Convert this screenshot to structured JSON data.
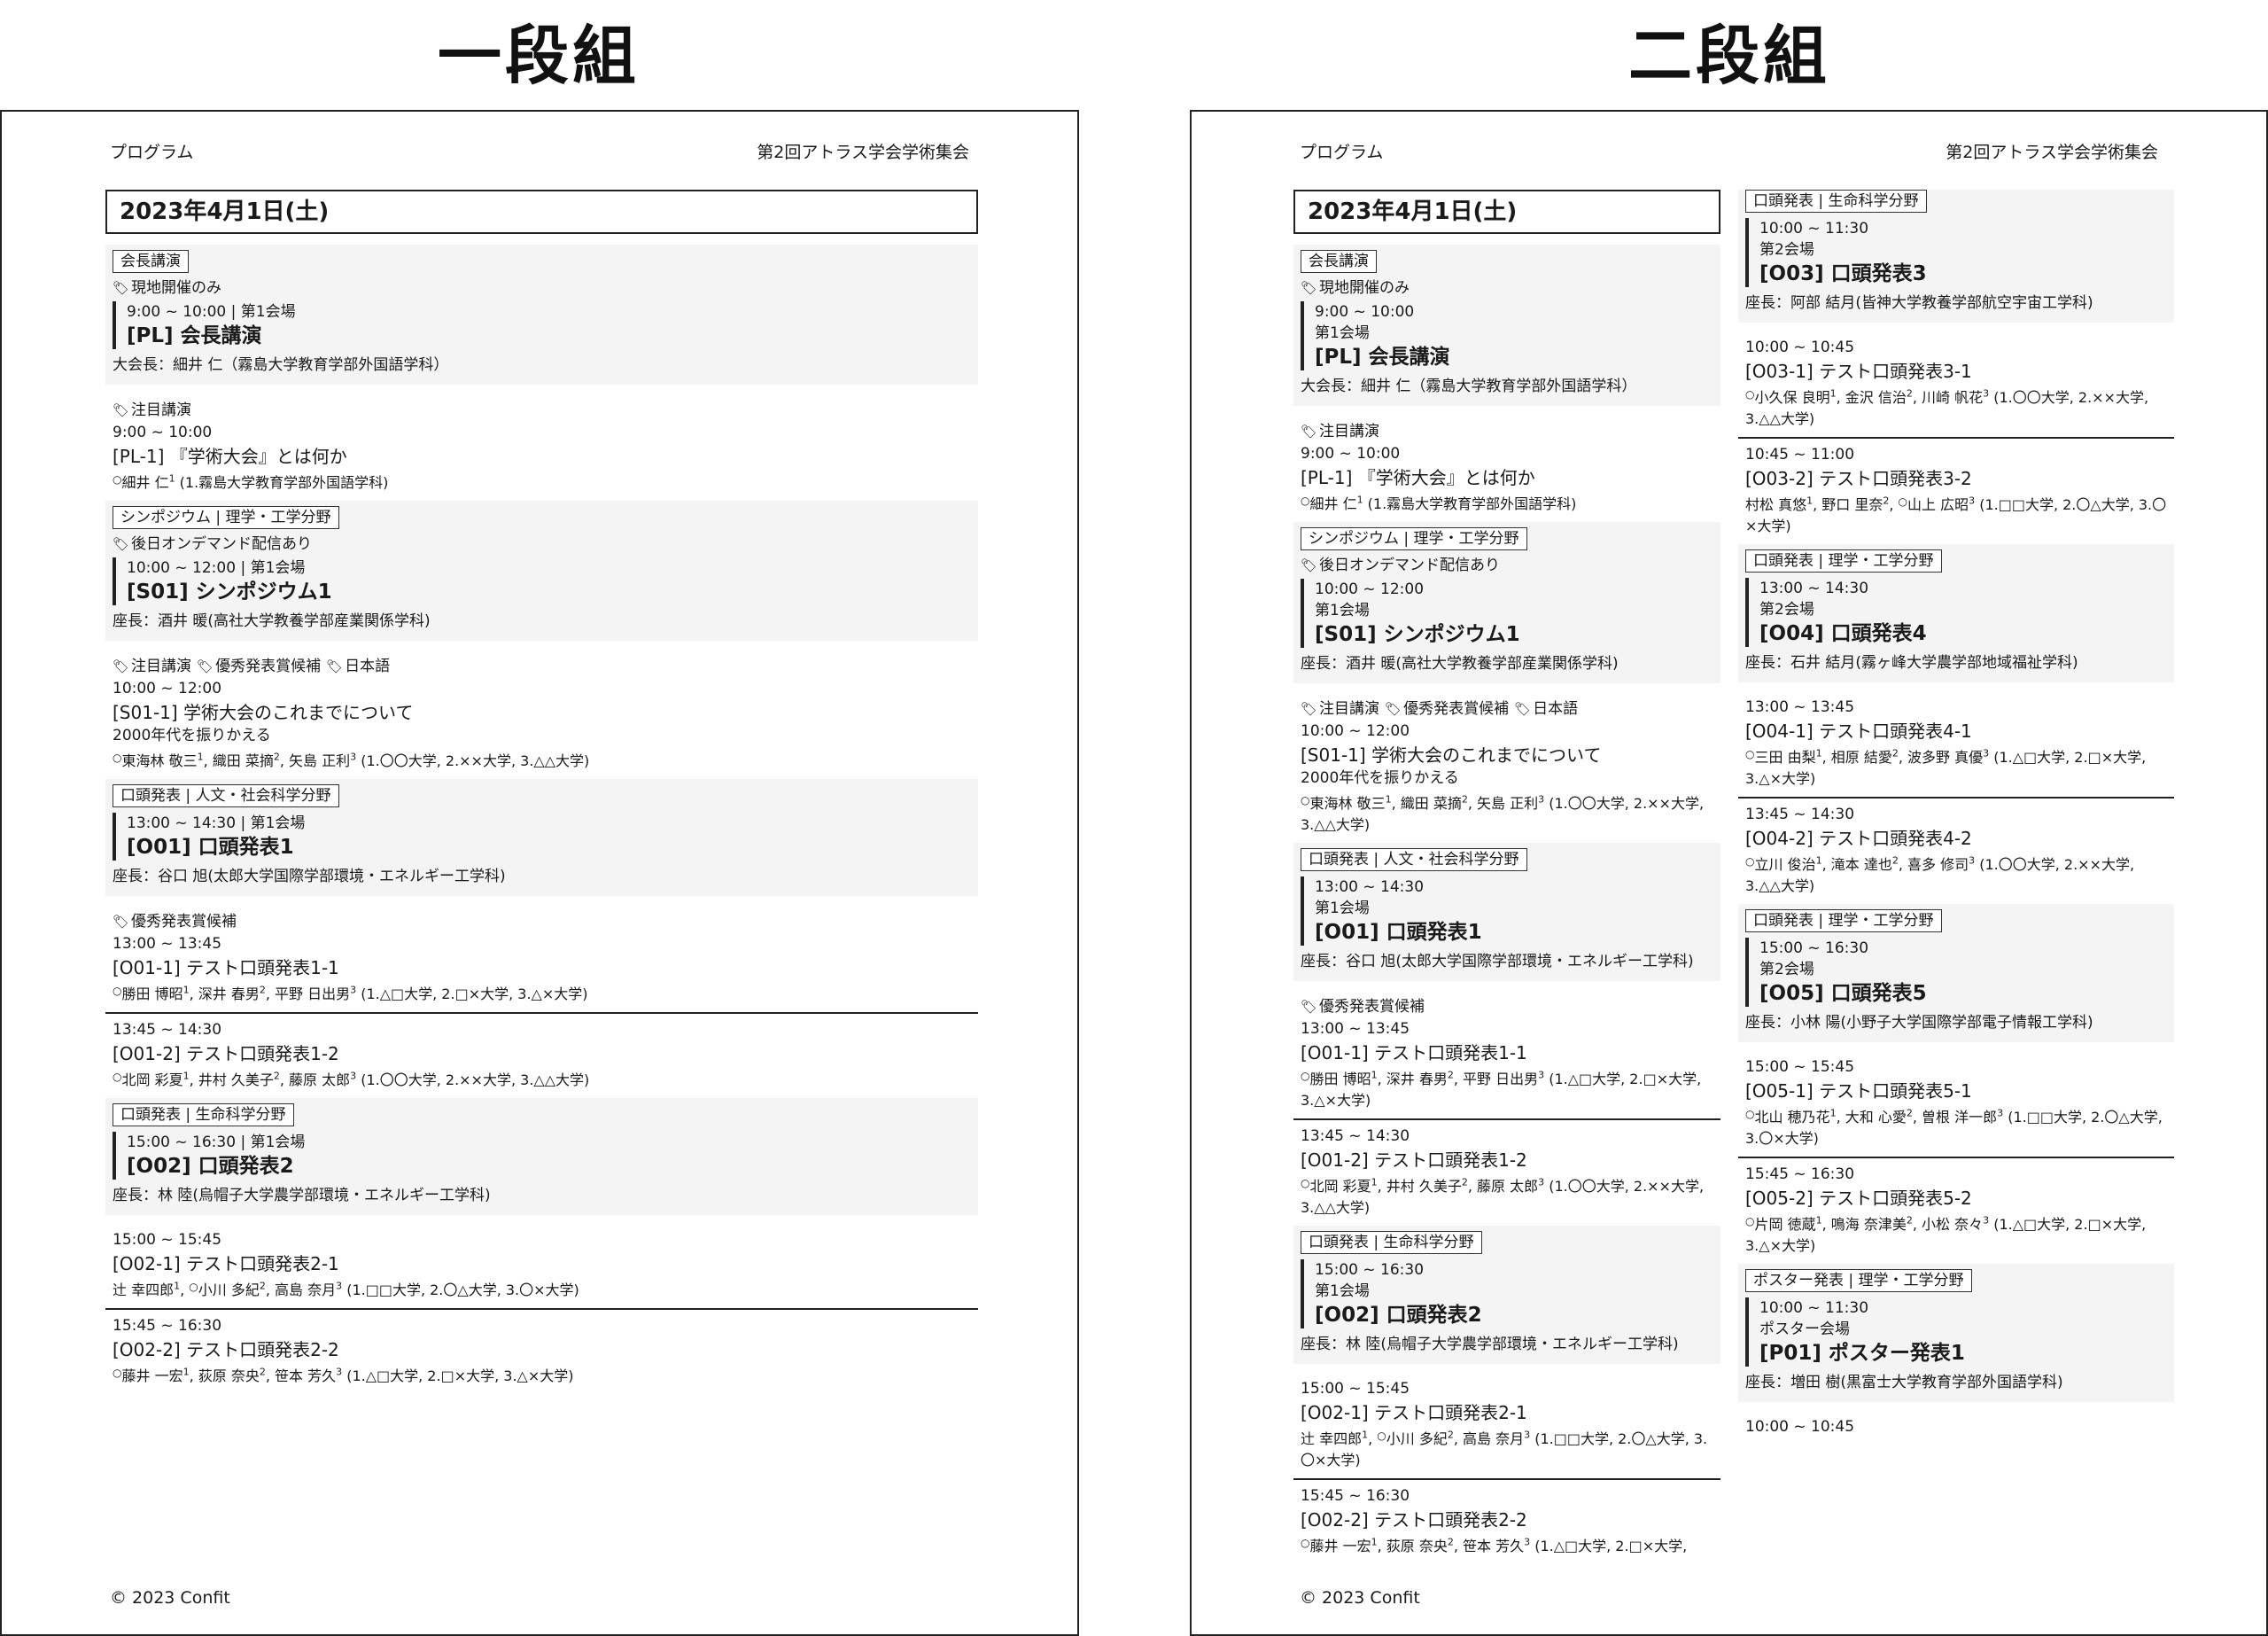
{
  "headings": {
    "single": "一段組",
    "double": "二段組"
  },
  "page_header": {
    "left": "プログラム",
    "right": "第2回アトラス学会学術集会"
  },
  "footer": "© 2023 Confit",
  "date": "2023年4月1日(土)",
  "presenter_mark": "○",
  "icons": {
    "tag": "tag-icon"
  },
  "sessions": [
    {
      "category": "会長講演",
      "tags": [
        "現地開催のみ"
      ],
      "time": "9:00 ~ 10:00",
      "room": "第1会場",
      "title": "[PL] 会長講演",
      "chair": "大会長：細井 仁（霧島大学教育学部外国語学科）",
      "talks": [
        {
          "tags": [
            "注目講演"
          ],
          "time": "9:00 ~ 10:00",
          "title": "[PL-1] 『学術大会』とは何か",
          "subtitle": "",
          "authors": [
            {
              "name": "細井 仁",
              "n": "1",
              "presenter": true
            }
          ],
          "affiliations": "(1.霧島大学教育学部外国語学科)"
        }
      ]
    },
    {
      "category": "シンポジウム | 理学・工学分野",
      "tags": [
        "後日オンデマンド配信あり"
      ],
      "time": "10:00 ~ 12:00",
      "room": "第1会場",
      "title": "[S01] シンポジウム1",
      "chair": "座長：酒井 暖(高社大学教養学部産業関係学科)",
      "talks": [
        {
          "tags": [
            "注目講演",
            "優秀発表賞候補",
            "日本語"
          ],
          "time": "10:00 ~ 12:00",
          "title": "[S01-1] 学術大会のこれまでについて",
          "subtitle": "2000年代を振りかえる",
          "authors": [
            {
              "name": "東海林 敬三",
              "n": "1",
              "presenter": true
            },
            {
              "name": "織田 菜摘",
              "n": "2",
              "presenter": false
            },
            {
              "name": "矢島 正利",
              "n": "3",
              "presenter": false
            }
          ],
          "affiliations": "(1.〇〇大学, 2.××大学, 3.△△大学)"
        }
      ]
    },
    {
      "category": "口頭発表 | 人文・社会科学分野",
      "tags": [],
      "time": "13:00 ~ 14:30",
      "room": "第1会場",
      "title": "[O01] 口頭発表1",
      "chair": "座長：谷口 旭(太郎大学国際学部環境・エネルギー工学科)",
      "talks": [
        {
          "tags": [
            "優秀発表賞候補"
          ],
          "time": "13:00 ~ 13:45",
          "title": "[O01-1] テスト口頭発表1-1",
          "subtitle": "",
          "authors": [
            {
              "name": "勝田 博昭",
              "n": "1",
              "presenter": true
            },
            {
              "name": "深井 春男",
              "n": "2",
              "presenter": false
            },
            {
              "name": "平野 日出男",
              "n": "3",
              "presenter": false
            }
          ],
          "affiliations": "(1.△□大学, 2.□×大学, 3.△×大学)"
        },
        {
          "tags": [],
          "time": "13:45 ~ 14:30",
          "title": "[O01-2] テスト口頭発表1-2",
          "subtitle": "",
          "authors": [
            {
              "name": "北岡 彩夏",
              "n": "1",
              "presenter": true
            },
            {
              "name": "井村 久美子",
              "n": "2",
              "presenter": false
            },
            {
              "name": "藤原 太郎",
              "n": "3",
              "presenter": false
            }
          ],
          "affiliations": "(1.〇〇大学, 2.××大学, 3.△△大学)"
        }
      ]
    },
    {
      "category": "口頭発表 | 生命科学分野",
      "tags": [],
      "time": "15:00 ~ 16:30",
      "room": "第1会場",
      "title": "[O02] 口頭発表2",
      "chair": "座長：林 陸(烏帽子大学農学部環境・エネルギー工学科)",
      "talks": [
        {
          "tags": [],
          "time": "15:00 ~ 15:45",
          "title": "[O02-1] テスト口頭発表2-1",
          "subtitle": "",
          "authors": [
            {
              "name": "辻 幸四郎",
              "n": "1",
              "presenter": false
            },
            {
              "name": "小川 多紀",
              "n": "2",
              "presenter": true
            },
            {
              "name": "高島 奈月",
              "n": "3",
              "presenter": false
            }
          ],
          "affiliations": "(1.□□大学, 2.〇△大学, 3.〇×大学)"
        },
        {
          "tags": [],
          "time": "15:45 ~ 16:30",
          "title": "[O02-2] テスト口頭発表2-2",
          "subtitle": "",
          "authors": [
            {
              "name": "藤井 一宏",
              "n": "1",
              "presenter": true
            },
            {
              "name": "荻原 奈央",
              "n": "2",
              "presenter": false
            },
            {
              "name": "笹本 芳久",
              "n": "3",
              "presenter": false
            }
          ],
          "affiliations": "(1.△□大学, 2.□×大学, 3.△×大学)"
        }
      ]
    },
    {
      "category": "口頭発表 | 生命科学分野",
      "tags": [],
      "time": "10:00 ~ 11:30",
      "room": "第2会場",
      "title": "[O03] 口頭発表3",
      "chair": "座長：阿部 結月(皆神大学教養学部航空宇宙工学科)",
      "talks": [
        {
          "tags": [],
          "time": "10:00 ~ 10:45",
          "title": "[O03-1] テスト口頭発表3-1",
          "subtitle": "",
          "authors": [
            {
              "name": "小久保 良明",
              "n": "1",
              "presenter": true
            },
            {
              "name": "金沢 信治",
              "n": "2",
              "presenter": false
            },
            {
              "name": "川崎 帆花",
              "n": "3",
              "presenter": false
            }
          ],
          "affiliations": "(1.〇〇大学, 2.××大学, 3.△△大学)"
        },
        {
          "tags": [],
          "time": "10:45 ~ 11:00",
          "title": "[O03-2] テスト口頭発表3-2",
          "subtitle": "",
          "authors": [
            {
              "name": "村松 真悠",
              "n": "1",
              "presenter": false
            },
            {
              "name": "野口 里奈",
              "n": "2",
              "presenter": false
            },
            {
              "name": "山上 広昭",
              "n": "3",
              "presenter": true
            }
          ],
          "affiliations": "(1.□□大学, 2.〇△大学, 3.〇×大学)"
        }
      ]
    },
    {
      "category": "口頭発表 | 理学・工学分野",
      "tags": [],
      "time": "13:00 ~ 14:30",
      "room": "第2会場",
      "title": "[O04] 口頭発表4",
      "chair": "座長：石井 結月(霧ヶ峰大学農学部地域福祉学科)",
      "talks": [
        {
          "tags": [],
          "time": "13:00 ~ 13:45",
          "title": "[O04-1] テスト口頭発表4-1",
          "subtitle": "",
          "authors": [
            {
              "name": "三田 由梨",
              "n": "1",
              "presenter": true
            },
            {
              "name": "相原 結愛",
              "n": "2",
              "presenter": false
            },
            {
              "name": "波多野 真優",
              "n": "3",
              "presenter": false
            }
          ],
          "affiliations": "(1.△□大学, 2.□×大学, 3.△×大学)"
        },
        {
          "tags": [],
          "time": "13:45 ~ 14:30",
          "title": "[O04-2] テスト口頭発表4-2",
          "subtitle": "",
          "authors": [
            {
              "name": "立川 俊治",
              "n": "1",
              "presenter": true
            },
            {
              "name": "滝本 達也",
              "n": "2",
              "presenter": false
            },
            {
              "name": "喜多 修司",
              "n": "3",
              "presenter": false
            }
          ],
          "affiliations": "(1.〇〇大学, 2.××大学, 3.△△大学)"
        }
      ]
    },
    {
      "category": "口頭発表 | 理学・工学分野",
      "tags": [],
      "time": "15:00 ~ 16:30",
      "room": "第2会場",
      "title": "[O05] 口頭発表5",
      "chair": "座長：小林 陽(小野子大学国際学部電子情報工学科)",
      "talks": [
        {
          "tags": [],
          "time": "15:00 ~ 15:45",
          "title": "[O05-1] テスト口頭発表5-1",
          "subtitle": "",
          "authors": [
            {
              "name": "北山 穂乃花",
              "n": "1",
              "presenter": true
            },
            {
              "name": "大和 心愛",
              "n": "2",
              "presenter": false
            },
            {
              "name": "曽根 洋一郎",
              "n": "3",
              "presenter": false
            }
          ],
          "affiliations": "(1.□□大学, 2.〇△大学, 3.〇×大学)"
        },
        {
          "tags": [],
          "time": "15:45 ~ 16:30",
          "title": "[O05-2] テスト口頭発表5-2",
          "subtitle": "",
          "authors": [
            {
              "name": "片岡 徳蔵",
              "n": "1",
              "presenter": true
            },
            {
              "name": "鳴海 奈津美",
              "n": "2",
              "presenter": false
            },
            {
              "name": "小松 奈々",
              "n": "3",
              "presenter": false
            }
          ],
          "affiliations": "(1.△□大学, 2.□×大学, 3.△×大学)"
        }
      ]
    },
    {
      "category": "ポスター発表 | 理学・工学分野",
      "tags": [],
      "time": "10:00 ~ 11:30",
      "room": "ポスター会場",
      "title": "[P01] ポスター発表1",
      "chair": "座長：増田 樹(黒富士大学教育学部外国語学科)",
      "talks": [
        {
          "tags": [],
          "time": "10:00 ~ 10:45",
          "title": "",
          "subtitle": "",
          "authors": [],
          "affiliations": ""
        }
      ]
    }
  ]
}
